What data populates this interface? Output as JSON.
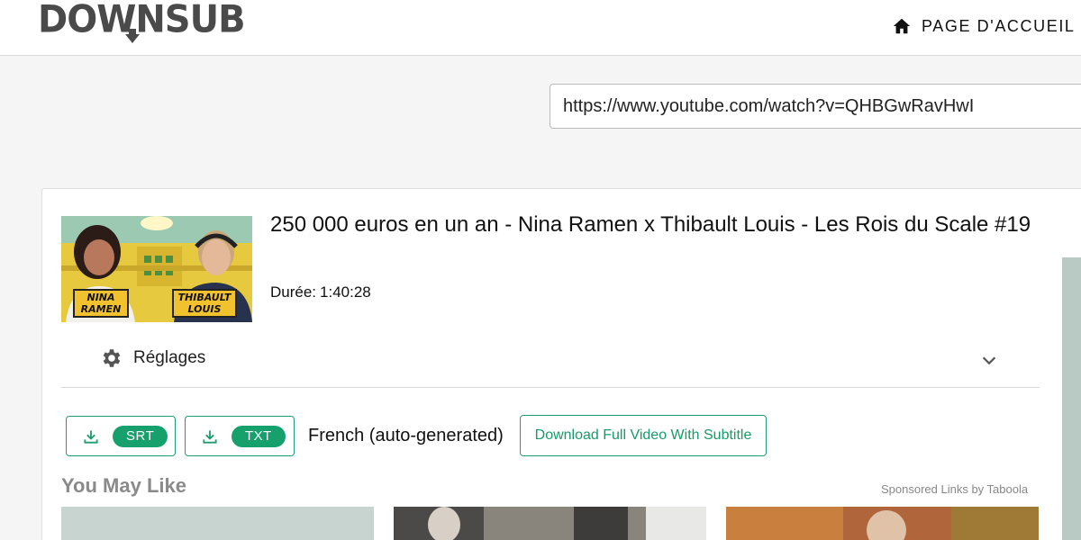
{
  "header": {
    "logo_text": "DOWNSUB",
    "home_label": "PAGE D'ACCUEIL",
    "home_icon": "home-icon"
  },
  "search": {
    "url_value": "https://www.youtube.com/watch?v=QHBGwRavHwI"
  },
  "video": {
    "title": "250 000 euros en un an - Nina Ramen x Thibault Louis - Les Rois du Scale #19",
    "duration_label": "Durée:",
    "duration_value": "1:40:28",
    "thumbnail": {
      "left_name": "NINA RAMEN",
      "right_name": "THIBAULT LOUIS"
    }
  },
  "settings": {
    "label": "Réglages",
    "icon": "gear-icon",
    "toggle_icon": "chevron-down-icon"
  },
  "subtitles": {
    "srt_label": "SRT",
    "txt_label": "TXT",
    "language": "French (auto-generated)",
    "full_video_label": "Download Full Video With Subtitle",
    "accent_color": "#15a06c"
  },
  "recommendations": {
    "heading": "You May Like",
    "sponsored": "Sponsored Links by Taboola"
  }
}
